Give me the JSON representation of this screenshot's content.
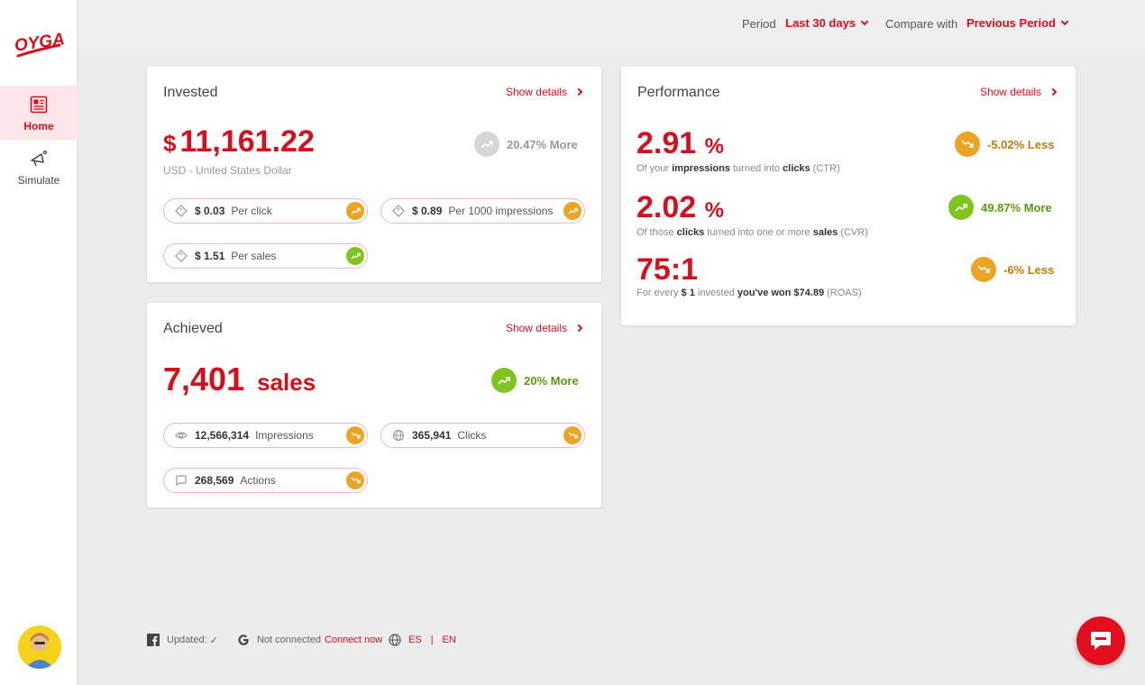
{
  "brand": {
    "logo_text": "OYGA!",
    "accent": "#d40f1e"
  },
  "sidebar": {
    "items": [
      {
        "label": "Home",
        "icon": "newspaper-icon",
        "active": true
      },
      {
        "label": "Simulate",
        "icon": "megaphone-icon",
        "active": false
      }
    ]
  },
  "header": {
    "period_label": "Period",
    "period_value": "Last 30 days",
    "compare_label": "Compare with",
    "compare_value": "Previous Period"
  },
  "invested": {
    "title": "Invested",
    "show_details": "Show details",
    "currency_symbol": "$",
    "amount": "11,161.22",
    "currency_name": "USD - United States Dollar",
    "trend": "20.47% More",
    "metrics": [
      {
        "value": "$ 0.03",
        "label": "Per click",
        "trend": "up"
      },
      {
        "value": "$ 0.89",
        "label": "Per 1000 impressions",
        "trend": "up"
      },
      {
        "value": "$ 1.51",
        "label": "Per sales",
        "trend": "up"
      }
    ]
  },
  "achieved": {
    "title": "Achieved",
    "show_details": "Show details",
    "amount": "7,401",
    "unit": "sales",
    "trend": "20% More",
    "metrics": [
      {
        "value": "12,566,314",
        "label": "Impressions",
        "trend": "down"
      },
      {
        "value": "365,941",
        "label": "Clicks",
        "trend": "down"
      },
      {
        "value": "268,569",
        "label": "Actions",
        "trend": "down"
      }
    ]
  },
  "performance": {
    "title": "Performance",
    "show_details": "Show details",
    "ctr": {
      "value": "2.91",
      "unit": "%",
      "desc_a": "Of your ",
      "desc_b": "impressions",
      "desc_c": " turned into ",
      "desc_d": "clicks",
      "desc_e": " (CTR)",
      "trend": "-5.02% Less"
    },
    "cvr": {
      "value": "2.02",
      "unit": "%",
      "desc_a": "Of those ",
      "desc_b": "clicks",
      "desc_c": " turned into one or more ",
      "desc_d": "sales",
      "desc_e": " (CVR)",
      "trend": "49.87% More"
    },
    "roas": {
      "value": "75:1",
      "desc_a": "For every ",
      "desc_b": "$ 1",
      "desc_c": " invested ",
      "desc_d": "you've won $74.89",
      "desc_e": " (ROAS)",
      "trend": "-6% Less"
    }
  },
  "footer": {
    "updated_label": "Updated:",
    "google_status": "Not connected",
    "connect_link": "Connect now",
    "lang_es": "ES",
    "lang_sep": "|",
    "lang_en": "EN"
  }
}
